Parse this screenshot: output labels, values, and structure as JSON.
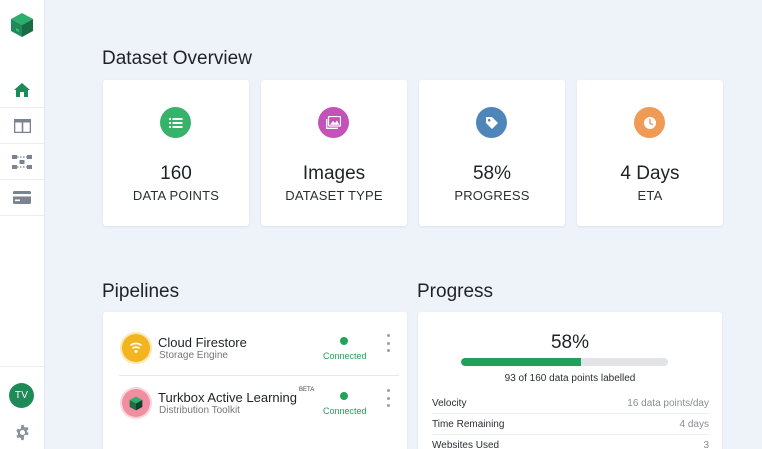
{
  "app": {
    "avatar_initials": "TV"
  },
  "colors": {
    "brand": "#1e8a57",
    "green": "#20a35a",
    "purple": "#c452b8",
    "blue": "#4f86b9",
    "orange": "#ef9a55",
    "stat_green": "#37b26b"
  },
  "sidebar": {
    "items": [
      {
        "icon": "home-icon",
        "active": true
      },
      {
        "icon": "columns-icon",
        "active": false
      },
      {
        "icon": "workflow-icon",
        "active": false
      },
      {
        "icon": "card-icon",
        "active": false
      }
    ]
  },
  "overview": {
    "title": "Dataset Overview",
    "stats": [
      {
        "icon": "list-icon",
        "value": "160",
        "label": "DATA POINTS"
      },
      {
        "icon": "image-icon",
        "value": "Images",
        "label": "DATASET TYPE"
      },
      {
        "icon": "tag-icon",
        "value": "58%",
        "label": "PROGRESS"
      },
      {
        "icon": "clock-icon",
        "value": "4 Days",
        "label": "ETA"
      }
    ]
  },
  "pipelines": {
    "title": "Pipelines",
    "items": [
      {
        "icon": "wifi-icon",
        "name": "Cloud Firestore",
        "badge": "",
        "subtitle": "Storage Engine",
        "status": "Connected"
      },
      {
        "icon": "cube-icon",
        "name": "Turkbox Active Learning",
        "badge": "BETA",
        "subtitle": "Distribution Toolkit",
        "status": "Connected"
      }
    ]
  },
  "progress": {
    "title": "Progress",
    "percent_text": "58%",
    "fraction": 0.58,
    "caption": "93 of 160 data points labelled",
    "rows": [
      {
        "label": "Velocity",
        "value": "16 data points/day"
      },
      {
        "label": "Time Remaining",
        "value": "4 days"
      },
      {
        "label": "Websites Used",
        "value": "3"
      }
    ]
  }
}
